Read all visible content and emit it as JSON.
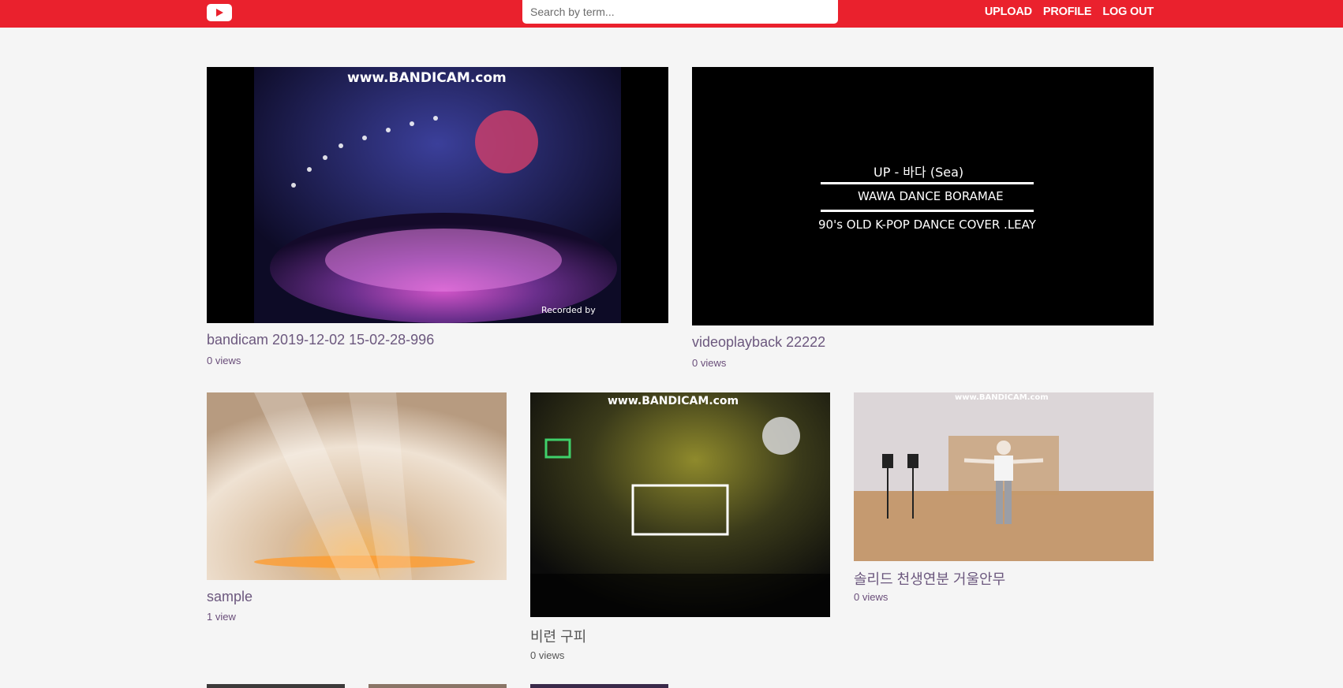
{
  "header": {
    "search_placeholder": "Search by term...",
    "nav": {
      "upload": "UPLOAD",
      "profile": "PROFILE",
      "logout": "LOG OUT"
    }
  },
  "videos": [
    {
      "title": "bandicam 2019-12-02 15-02-28-996",
      "views": "0 views",
      "overlay_top": "www.BANDICAM.com",
      "overlay_bottom": "Recorded by"
    },
    {
      "title": "videoplayback 22222",
      "views": "0 views",
      "overlay_lines": [
        "UP - 바다 (Sea)",
        "WAWA DANCE BORAMAE",
        "90's OLD K-POP DANCE COVER .LEAY"
      ]
    },
    {
      "title": "sample",
      "views": "1 view"
    },
    {
      "title": "비련 구피",
      "views": "0 views",
      "overlay_top": "www.BANDICAM.com"
    },
    {
      "title": "솔리드 천생연분 거울안무",
      "views": "0 views",
      "overlay_top": "www.BANDICAM.com"
    }
  ],
  "colors": {
    "brand": "#ea212d",
    "background": "#f5f5f5",
    "title": "#6c587e"
  }
}
